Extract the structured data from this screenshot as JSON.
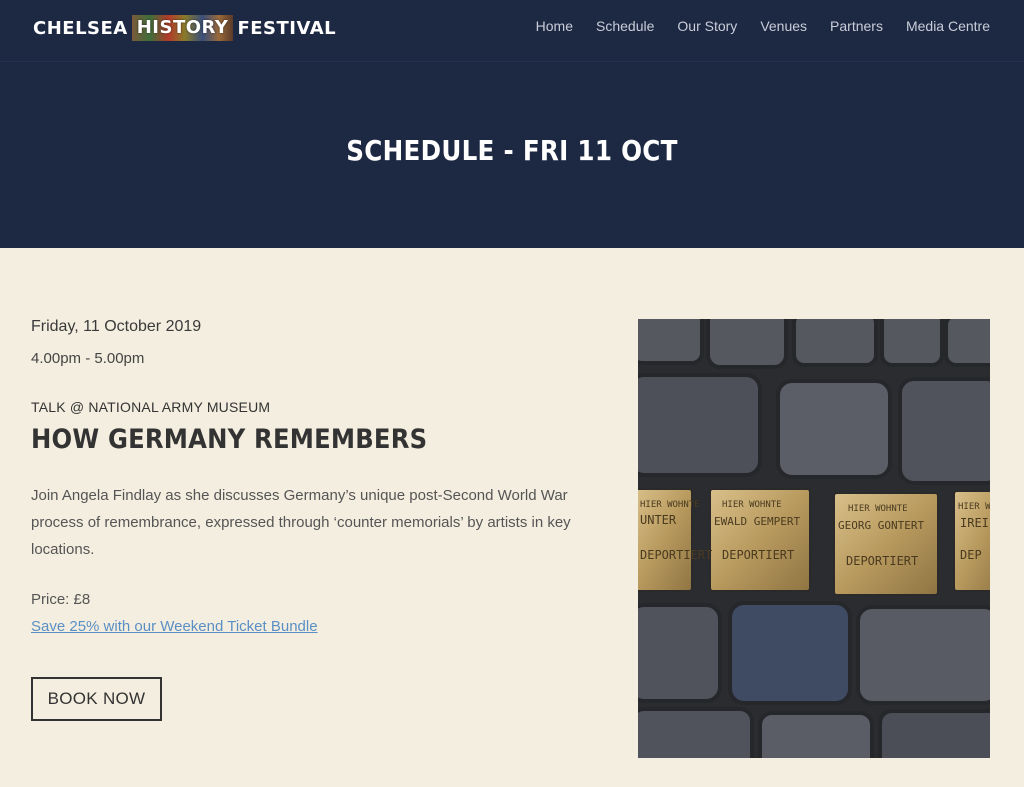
{
  "header": {
    "logo": {
      "word1": "CHELSEA",
      "word2": "HISTORY",
      "word3": "FESTIVAL"
    },
    "nav": [
      "Home",
      "Schedule",
      "Our Story",
      "Venues",
      "Partners",
      "Media Centre"
    ]
  },
  "hero": {
    "title": "SCHEDULE - FRI 11 OCT"
  },
  "event": {
    "date": "Friday, 11 October 2019",
    "time": "4.00pm - 5.00pm",
    "kicker": "TALK @ NATIONAL ARMY MUSEUM",
    "title": "HOW GERMANY REMEMBERS",
    "description": "Join Angela Findlay as she discusses Germany’s unique post-Second World War process of remembrance, expressed through ‘counter memorials’ by artists in key locations.",
    "price": "Price: £8",
    "bundle_link": "Save 25% with our Weekend Ticket Bundle",
    "book_label": "BOOK NOW"
  },
  "photo": {
    "stones": [
      {
        "line1": "HIER WOHNTE",
        "line2": "UNTER",
        "line3": "DEPORTIERT"
      },
      {
        "line1": "HIER WOHNTE",
        "line2": "EWALD GEMPERT",
        "line3": "DEPORTIERT"
      },
      {
        "line1": "HIER WOHNTE",
        "line2": "GEORG GONTERT",
        "line3": "DEPORTIERT"
      },
      {
        "line1": "HIER WOHNTE",
        "line2": "IREI",
        "line3": "DEP"
      }
    ]
  },
  "colors": {
    "navy": "#1d2843",
    "cream": "#f4eee0",
    "link": "#5a8fc4"
  }
}
